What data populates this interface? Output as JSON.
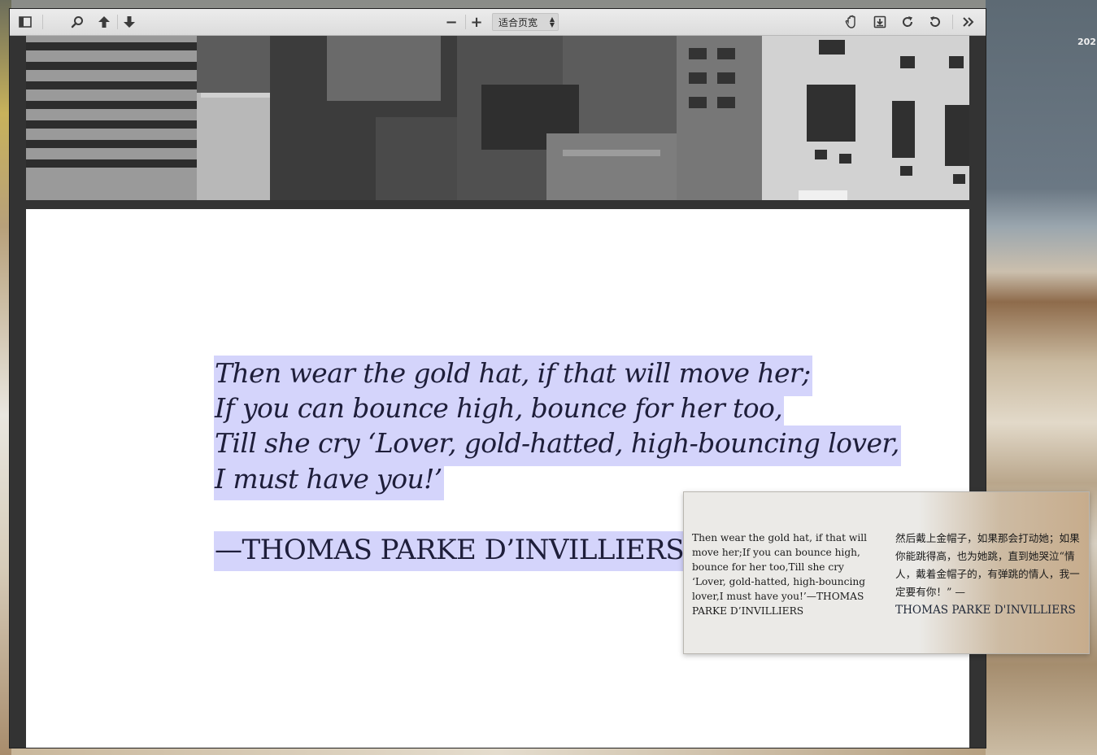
{
  "desktop": {
    "date_fragment": "202"
  },
  "toolbar": {
    "sidebar_icon": "sidebar-toggle-icon",
    "search_icon": "search-icon",
    "prev_icon": "arrow-up-icon",
    "next_icon": "arrow-down-icon",
    "zoom_out": "−",
    "zoom_in": "+",
    "zoom_value": "适合页宽",
    "hand_icon": "hand-tool-icon",
    "download_icon": "download-icon",
    "rotate_cw_icon": "rotate-clockwise-icon",
    "rotate_ccw_icon": "rotate-counterclockwise-icon",
    "more_icon": "double-chevron-right-icon"
  },
  "document": {
    "poem_lines": [
      "Then wear the gold hat, if that will move her;",
      "If you can bounce high, bounce for her too,",
      "Till she cry ‘Lover, gold-hatted, high-bouncing lover,",
      "I must have you!’"
    ],
    "attribution": "—THOMAS PARKE D’INVILLIERS"
  },
  "translation_popup": {
    "source_text": "Then wear the gold hat, if that will move her;If you can bounce high, bounce for her too,Till she cry ‘Lover, gold-hatted, high-bouncing lover,I must have you!’—THOMAS PARKE D’INVILLIERS",
    "translated_text": "然后戴上金帽子，如果那会打动她；如果你能跳得高，也为她跳，直到她哭泣“情人，戴着金帽子的，有弹跳的情人，我一定要有你！” —",
    "translated_name": "THOMAS PARKE D'INVILLIERS"
  }
}
